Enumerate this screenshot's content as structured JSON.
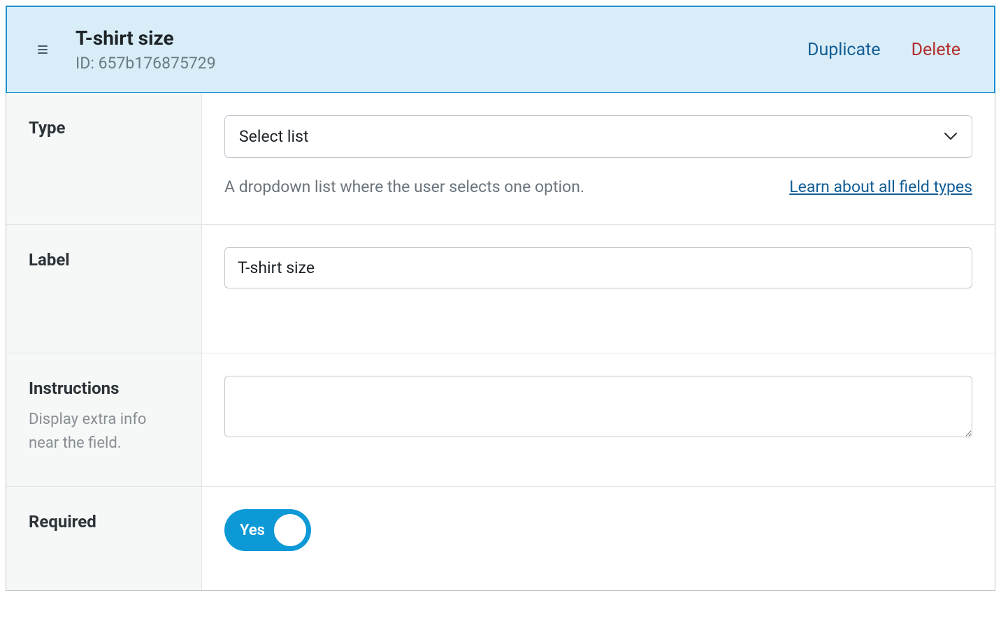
{
  "header": {
    "title": "T-shirt size",
    "id_prefix": "ID: ",
    "id_value": "657b176875729",
    "duplicate_label": "Duplicate",
    "delete_label": "Delete"
  },
  "type": {
    "row_label": "Type",
    "selected": "Select list",
    "description": "A dropdown list where the user selects one option.",
    "learn_link": "Learn about all field types"
  },
  "label": {
    "row_label": "Label",
    "value": "T-shirt size"
  },
  "instructions": {
    "row_label": "Instructions",
    "help_text": "Display extra info near the field.",
    "value": ""
  },
  "required": {
    "row_label": "Required",
    "toggle_on_label": "Yes",
    "is_on": true
  }
}
